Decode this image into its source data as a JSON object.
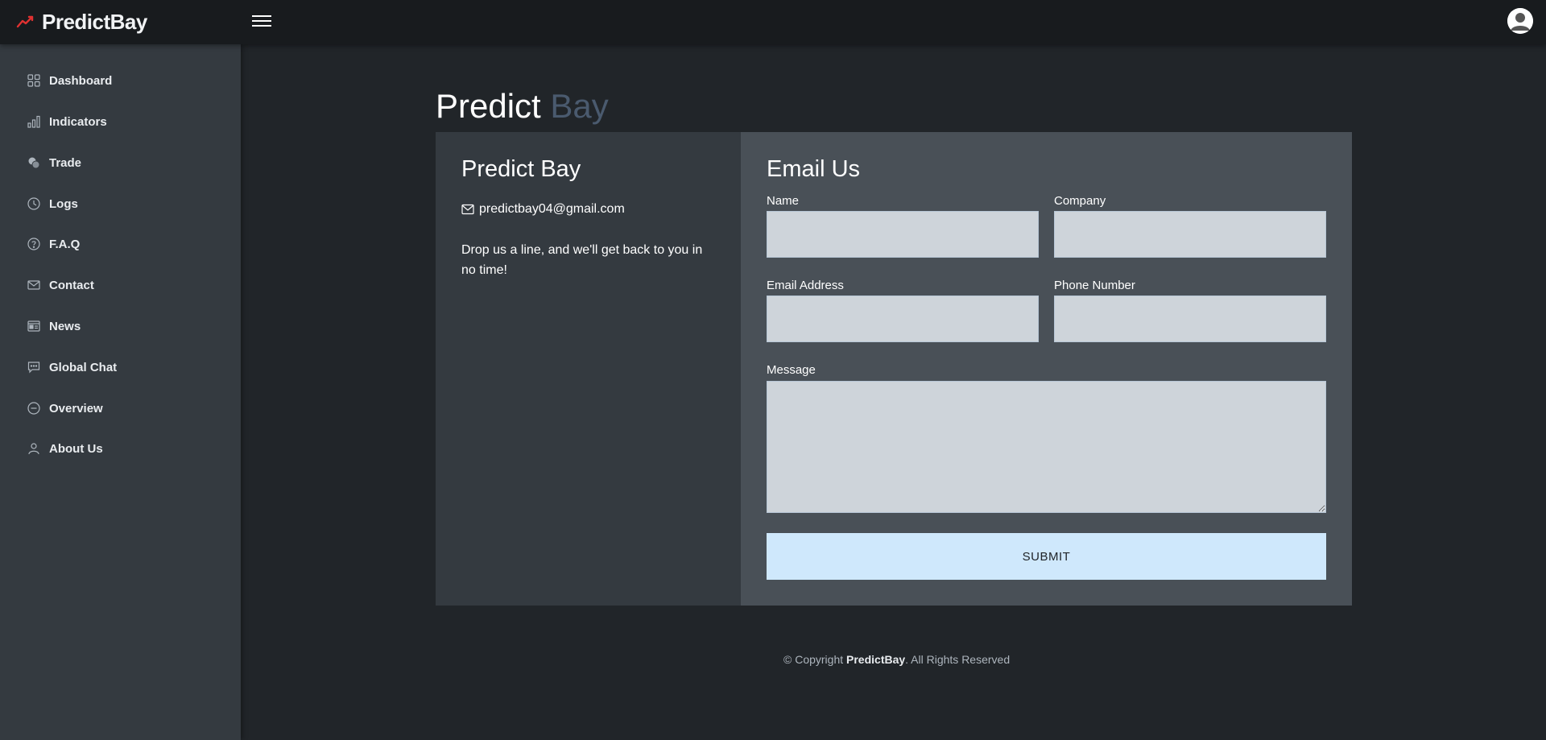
{
  "topbar": {
    "brand": "PredictBay",
    "brand_icon": "trend-line-icon",
    "menu_icon": "hamburger-menu-icon",
    "avatar_icon": "user-avatar-icon"
  },
  "sidebar": {
    "items": [
      {
        "label": "Dashboard",
        "icon": "grid-icon"
      },
      {
        "label": "Indicators",
        "icon": "bar-chart-icon"
      },
      {
        "label": "Trade",
        "icon": "coins-icon"
      },
      {
        "label": "Logs",
        "icon": "clock-icon"
      },
      {
        "label": "F.A.Q",
        "icon": "question-circle-icon"
      },
      {
        "label": "Contact",
        "icon": "envelope-icon"
      },
      {
        "label": "News",
        "icon": "newspaper-icon"
      },
      {
        "label": "Global Chat",
        "icon": "chat-icon"
      },
      {
        "label": "Overview",
        "icon": "dash-circle-icon"
      },
      {
        "label": "About Us",
        "icon": "person-icon"
      }
    ]
  },
  "page": {
    "title_main": "Predict",
    "title_accent": "Bay"
  },
  "info": {
    "title": "Predict Bay",
    "email": "predictbay04@gmail.com",
    "text": "Drop us a line, and we'll get back to you in no time!"
  },
  "form": {
    "title": "Email Us",
    "name_label": "Name",
    "name_value": "",
    "company_label": "Company",
    "company_value": "",
    "email_label": "Email Address",
    "email_value": "",
    "phone_label": "Phone Number",
    "phone_value": "",
    "message_label": "Message",
    "message_value": "",
    "submit_label": "SUBMIT"
  },
  "footer": {
    "prefix": "© Copyright ",
    "brand": "PredictBay",
    "suffix": ". All Rights Reserved"
  },
  "colors": {
    "accent": "#4a5a6e",
    "brand_icon": "#e03131",
    "submit_bg": "#cfe8fc"
  }
}
